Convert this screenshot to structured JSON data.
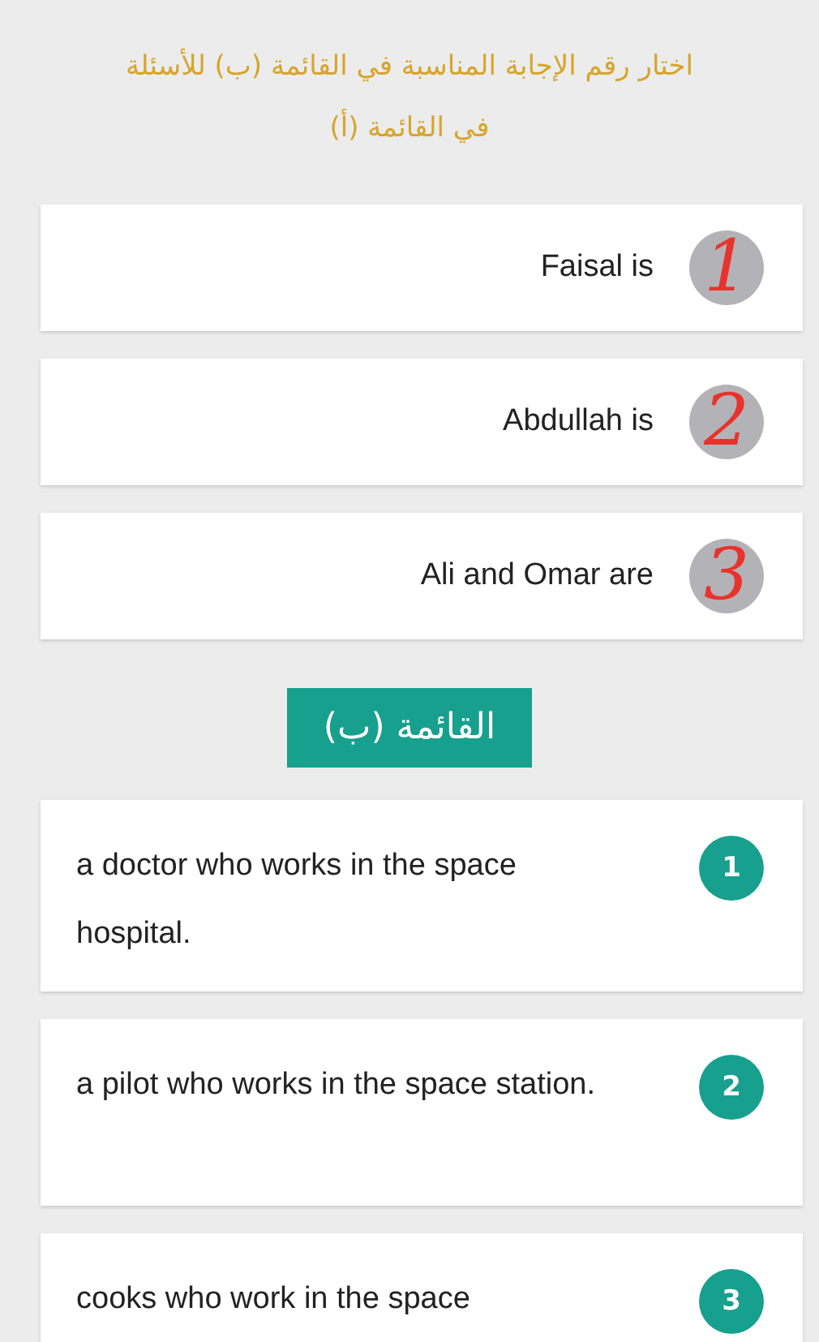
{
  "instruction_lines": [
    "اختار رقم الإجابة المناسبة في القائمة (ب) للأسئلة",
    "في القائمة (أ)"
  ],
  "list_a": [
    {
      "text": "Faisal is",
      "answer": "1"
    },
    {
      "text": "Abdullah is",
      "answer": "2"
    },
    {
      "text": "Ali and Omar are",
      "answer": "3"
    }
  ],
  "list_b": {
    "title": "القائمة (ب)",
    "items": [
      {
        "number": "1",
        "text": "a doctor who works in the space hospital."
      },
      {
        "number": "2",
        "text": "a pilot who works in the space station."
      },
      {
        "number": "3",
        "text": "cooks who work in the space"
      }
    ]
  }
}
